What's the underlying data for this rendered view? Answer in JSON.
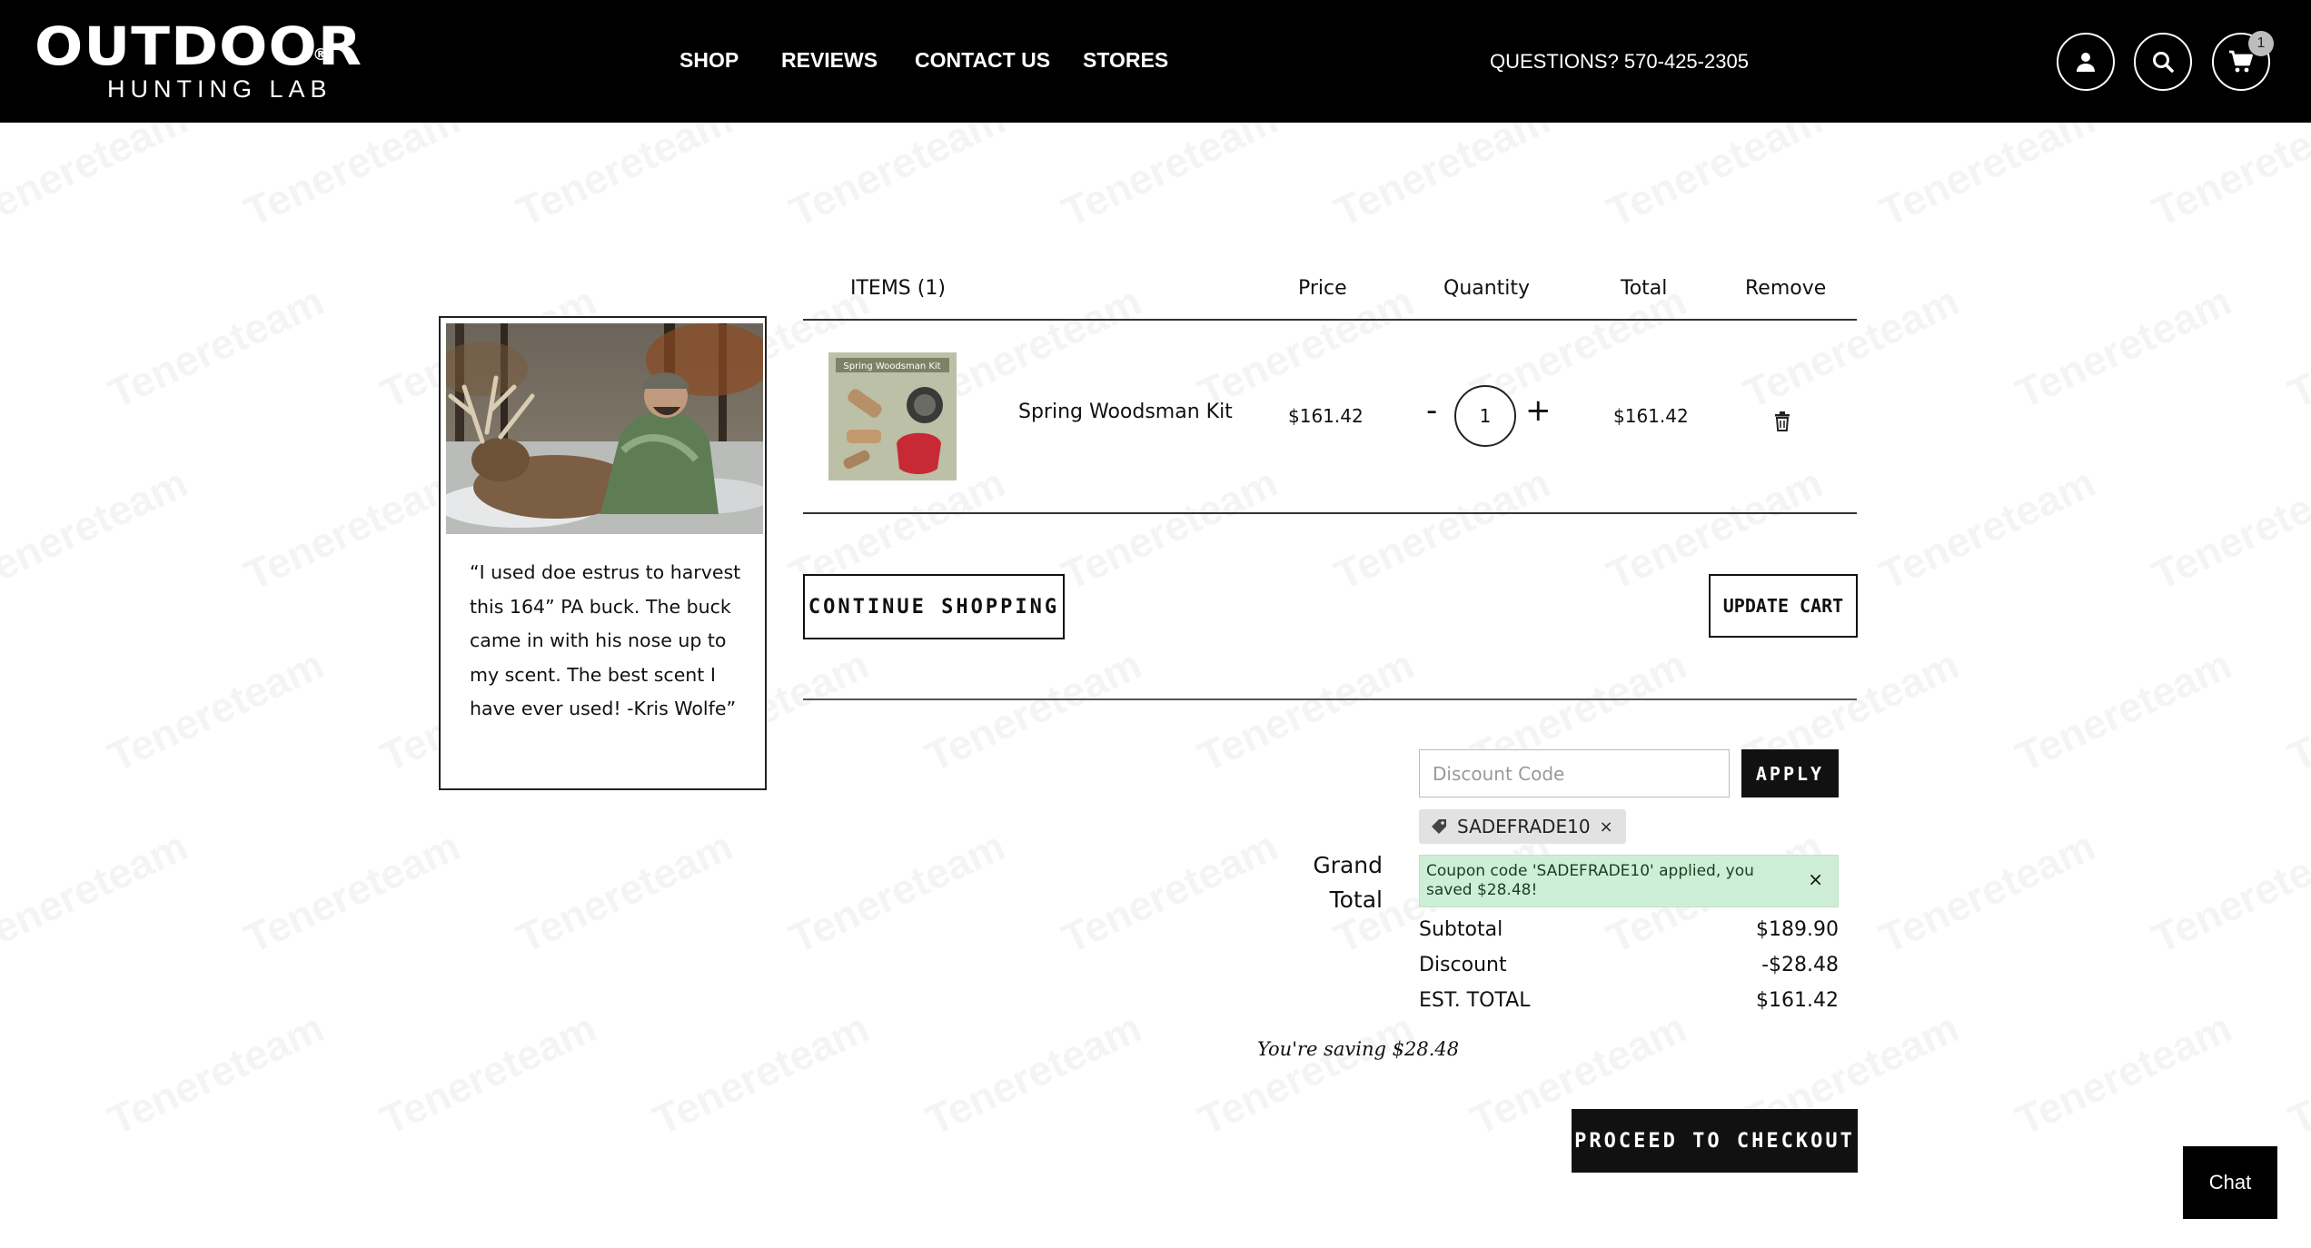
{
  "brand": {
    "logo_main": "OUTDOOR",
    "logo_sub": "HUNTING LAB",
    "logo_mark": "®"
  },
  "nav": {
    "items": [
      {
        "label": "SHOP"
      },
      {
        "label": "REVIEWS"
      },
      {
        "label": "CONTACT US"
      },
      {
        "label": "STORES"
      }
    ],
    "questions": "QUESTIONS? 570-425-2305",
    "cart_count": "1",
    "icons": [
      "account-icon",
      "search-icon",
      "cart-icon"
    ]
  },
  "watermark": "Tenereteam",
  "testimonial": {
    "quote": "“I used doe estrus to harvest this 164” PA buck. The buck came in with his nose up to my scent. The best scent I have ever used! -Kris Wolfe”"
  },
  "cart": {
    "headers": {
      "items": "ITEMS (1)",
      "price": "Price",
      "quantity": "Quantity",
      "total": "Total",
      "remove": "Remove"
    },
    "rows": [
      {
        "thumb_caption": "Spring Woodsman Kit",
        "name": "Spring Woodsman Kit",
        "price": "$161.42",
        "minus": "-",
        "quantity": "1",
        "plus": "+",
        "total": "$161.42"
      }
    ],
    "continue_label": "CONTINUE SHOPPING",
    "update_label": "UPDATE CART"
  },
  "totals": {
    "discount_placeholder": "Discount Code",
    "discount_value": "",
    "apply_label": "APPLY",
    "coupon_code": "SADEFRADE10",
    "coupon_remove": "×",
    "grand_total_label": "Grand Total",
    "alert_text": "Coupon code 'SADEFRADE10' applied, you saved $28.48!",
    "alert_close": "×",
    "subtotal_label": "Subtotal",
    "subtotal_value": "$189.90",
    "discount_label": "Discount",
    "discount_amount": "-$28.48",
    "est_total_label": "EST. TOTAL",
    "est_total_value": "$161.42",
    "saving_text": "You're saving $28.48",
    "checkout_label": "PROCEED TO CHECKOUT"
  },
  "chat": {
    "label": "Chat"
  },
  "colors": {
    "header_bg": "#000000",
    "alert_bg": "#cfeed6",
    "button_dark": "#111111",
    "coupon_tag_bg": "#e2e2e2"
  }
}
